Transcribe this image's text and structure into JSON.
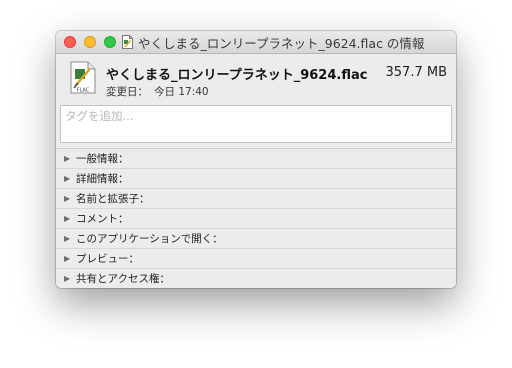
{
  "window": {
    "title": "やくしまる_ロンリープラネット_9624.flac の情報",
    "controls": [
      "close",
      "minimize",
      "zoom"
    ]
  },
  "header": {
    "file_name": "やくしまる_ロンリープラネット_9624.flac",
    "file_size": "357.7 MB",
    "modified_label": "変更日：",
    "modified_value": "今日 17:40",
    "file_icon": "flac-document-icon",
    "file_icon_label": "FLAC"
  },
  "tags": {
    "placeholder": "タグを追加..."
  },
  "sections": [
    {
      "label": "一般情報："
    },
    {
      "label": "詳細情報："
    },
    {
      "label": "名前と拡張子："
    },
    {
      "label": "コメント："
    },
    {
      "label": "このアプリケーションで開く："
    },
    {
      "label": "プレビュー："
    },
    {
      "label": "共有とアクセス権："
    }
  ],
  "colors": {
    "close": "#fc5f57",
    "minimize": "#fdbc2f",
    "zoom": "#33c748",
    "window_bg": "#ececec"
  }
}
